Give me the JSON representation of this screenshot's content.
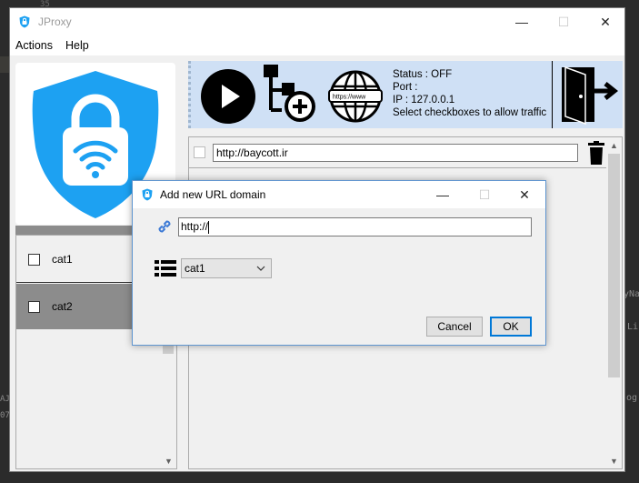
{
  "background": {
    "line_number": "35",
    "right_snippets": [
      "yNa",
      "Li",
      "og"
    ],
    "left_snippets": [
      "AJ",
      "07"
    ]
  },
  "window": {
    "title": "JProxy",
    "controls": {
      "minimize": "—",
      "maximize": "☐",
      "close": "✕"
    }
  },
  "menu": {
    "actions": "Actions",
    "help": "Help"
  },
  "categories": [
    {
      "label": "cat1",
      "selected": false,
      "checked": false
    },
    {
      "label": "cat2",
      "selected": true,
      "checked": false
    }
  ],
  "toolbar": {
    "play_icon": "play-icon",
    "add_category_icon": "add-category-icon",
    "add_url_icon": "globe-url-icon",
    "globe_label": "https://www",
    "exit_icon": "exit-door-icon"
  },
  "status": {
    "status_line": "Status : OFF",
    "port_line": "Port :",
    "ip_line": "IP : 127.0.0.1",
    "hint_line": "Select checkboxes to allow traffic"
  },
  "urls": [
    {
      "value": "http://baycott.ir",
      "checked": false
    }
  ],
  "dialog": {
    "title": "Add new URL domain",
    "url_value": "http://",
    "category_selected": "cat1",
    "cancel_label": "Cancel",
    "ok_label": "OK"
  },
  "colors": {
    "accent": "#0078d7",
    "toolbar_bg": "#cfe0f5",
    "shield_blue": "#1da1f2",
    "selected_row": "#8c8c8c"
  }
}
